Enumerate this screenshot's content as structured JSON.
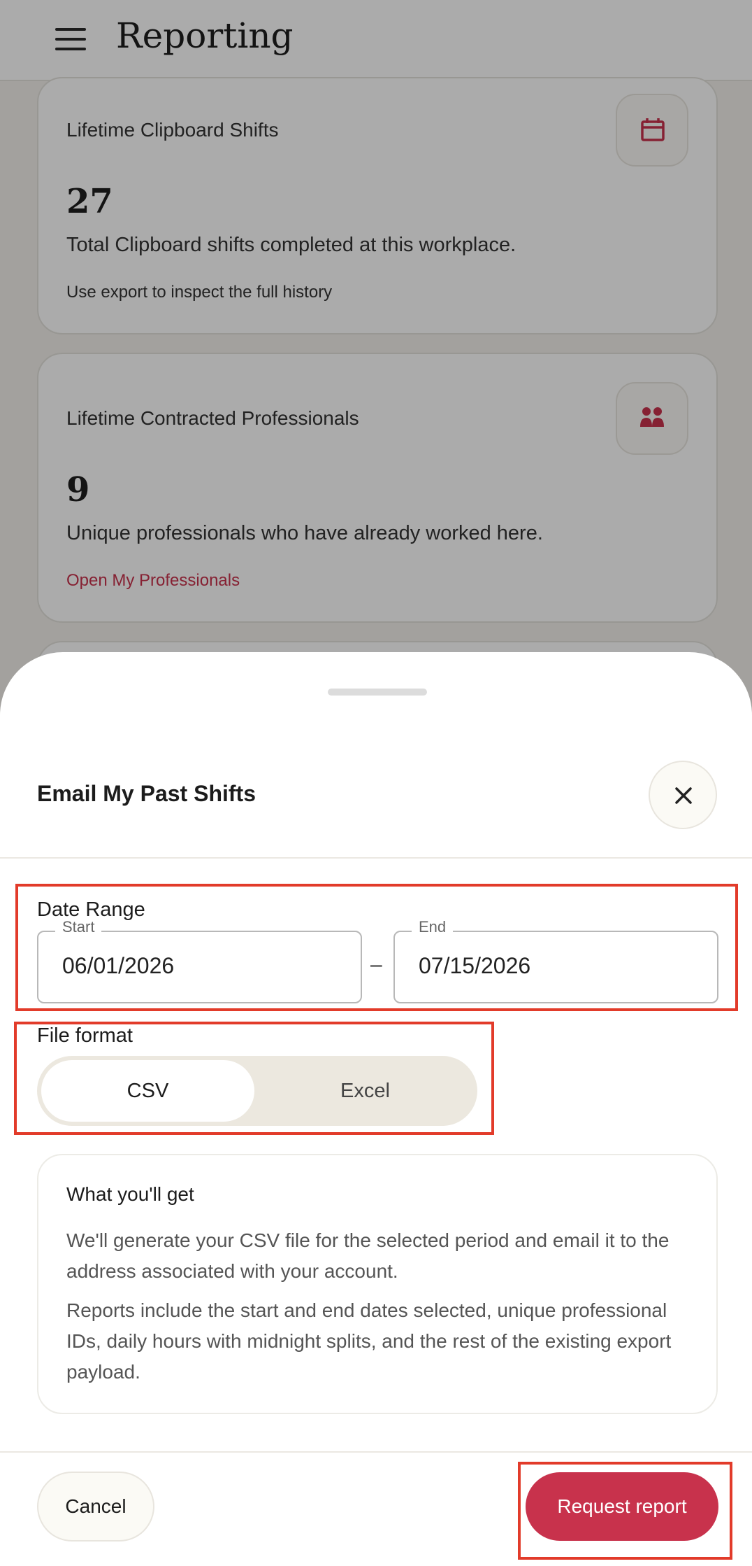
{
  "header": {
    "title": "Reporting"
  },
  "cards": [
    {
      "title": "Lifetime Clipboard Shifts",
      "value": "27",
      "description": "Total Clipboard shifts completed at this workplace.",
      "note": "Use export to inspect the full history",
      "icon": "calendar-icon"
    },
    {
      "title": "Lifetime Contracted Professionals",
      "value": "9",
      "description": "Unique professionals who have already worked here.",
      "link": "Open My Professionals",
      "icon": "people-icon"
    }
  ],
  "sheet": {
    "title": "Email My Past Shifts",
    "date_range": {
      "label": "Date Range",
      "start_label": "Start",
      "start_value": "06/01/2026",
      "separator": "–",
      "end_label": "End",
      "end_value": "07/15/2026"
    },
    "file_format": {
      "label": "File format",
      "options": [
        "CSV",
        "Excel"
      ],
      "selected": "CSV"
    },
    "info": {
      "title": "What you'll get",
      "p1": "We'll generate your CSV file for the selected period and email it to the address associated with your account.",
      "p2": "Reports include the start and end dates selected, unique professional IDs, daily hours with midnight splits, and the rest of the existing export payload."
    },
    "cancel_label": "Cancel",
    "submit_label": "Request report"
  },
  "colors": {
    "accent": "#c8324c",
    "highlight": "#e23b2a",
    "segment_bg": "#ece8df"
  }
}
